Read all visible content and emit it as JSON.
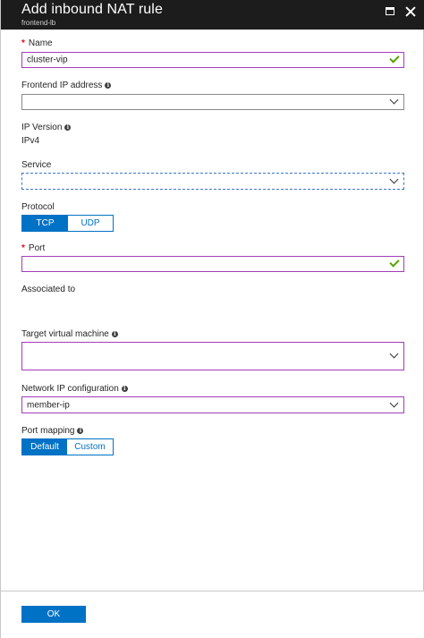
{
  "header": {
    "title": "Add inbound NAT rule",
    "subtitle": "frontend-lb"
  },
  "form": {
    "name": {
      "required_mark": "*",
      "label": "Name",
      "value": "cluster-vip"
    },
    "frontend_ip": {
      "label": "Frontend IP address",
      "value": ""
    },
    "ip_version": {
      "label": "IP Version",
      "value": "IPv4"
    },
    "service": {
      "label": "Service",
      "value": ""
    },
    "protocol": {
      "label": "Protocol",
      "options": [
        "TCP",
        "UDP"
      ],
      "selected": "TCP"
    },
    "port": {
      "required_mark": "*",
      "label": "Port",
      "value": ""
    },
    "associated_to": {
      "label": "Associated to"
    },
    "target_vm": {
      "label": "Target virtual machine",
      "value": ""
    },
    "network_ip_config": {
      "label": "Network IP configuration",
      "value": "member-ip"
    },
    "port_mapping": {
      "label": "Port mapping",
      "options": [
        "Default",
        "Custom"
      ],
      "selected": "Default"
    }
  },
  "footer": {
    "ok_label": "OK"
  },
  "colors": {
    "header_bg": "#1c1c1c",
    "accent": "#0072c6",
    "valid_border": "#a43cba",
    "check": "#57a300",
    "required": "#e00b1c"
  }
}
